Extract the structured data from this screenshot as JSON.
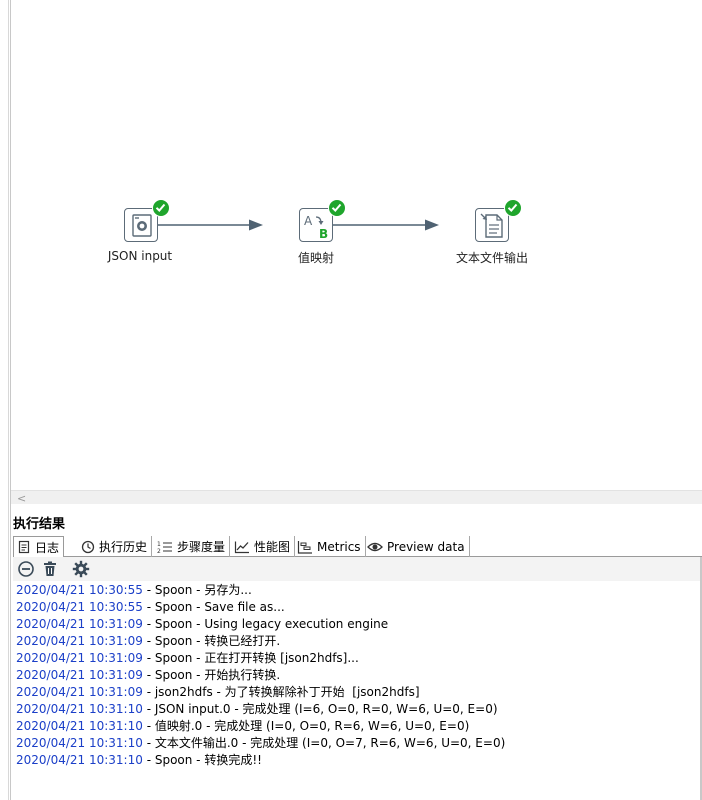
{
  "canvas": {
    "steps": [
      {
        "label": "JSON input"
      },
      {
        "label": "值映射"
      },
      {
        "label": "文本文件输出"
      }
    ]
  },
  "results": {
    "title": "执行结果",
    "tabs": [
      {
        "label": "日志"
      },
      {
        "label": "执行历史"
      },
      {
        "label": "步骤度量"
      },
      {
        "label": "性能图"
      },
      {
        "label": "Metrics"
      },
      {
        "label": "Preview data"
      }
    ],
    "log": [
      {
        "ts": "2020/04/21 10:30:55",
        "msg": " - Spoon - 另存为..."
      },
      {
        "ts": "2020/04/21 10:30:55",
        "msg": " - Spoon - Save file as..."
      },
      {
        "ts": "2020/04/21 10:31:09",
        "msg": " - Spoon - Using legacy execution engine"
      },
      {
        "ts": "2020/04/21 10:31:09",
        "msg": " - Spoon - 转换已经打开."
      },
      {
        "ts": "2020/04/21 10:31:09",
        "msg": " - Spoon - 正在打开转换 [json2hdfs]..."
      },
      {
        "ts": "2020/04/21 10:31:09",
        "msg": " - Spoon - 开始执行转换."
      },
      {
        "ts": "2020/04/21 10:31:09",
        "msg": " - json2hdfs - 为了转换解除补丁开始  [json2hdfs]"
      },
      {
        "ts": "2020/04/21 10:31:10",
        "msg": " - JSON input.0 - 完成处理 (I=6, O=0, R=0, W=6, U=0, E=0)"
      },
      {
        "ts": "2020/04/21 10:31:10",
        "msg": " - 值映射.0 - 完成处理 (I=0, O=0, R=6, W=6, U=0, E=0)"
      },
      {
        "ts": "2020/04/21 10:31:10",
        "msg": " - 文本文件输出.0 - 完成处理 (I=0, O=7, R=6, W=6, U=0, E=0)"
      },
      {
        "ts": "2020/04/21 10:31:10",
        "msg": " - Spoon - 转换完成!!"
      }
    ]
  }
}
